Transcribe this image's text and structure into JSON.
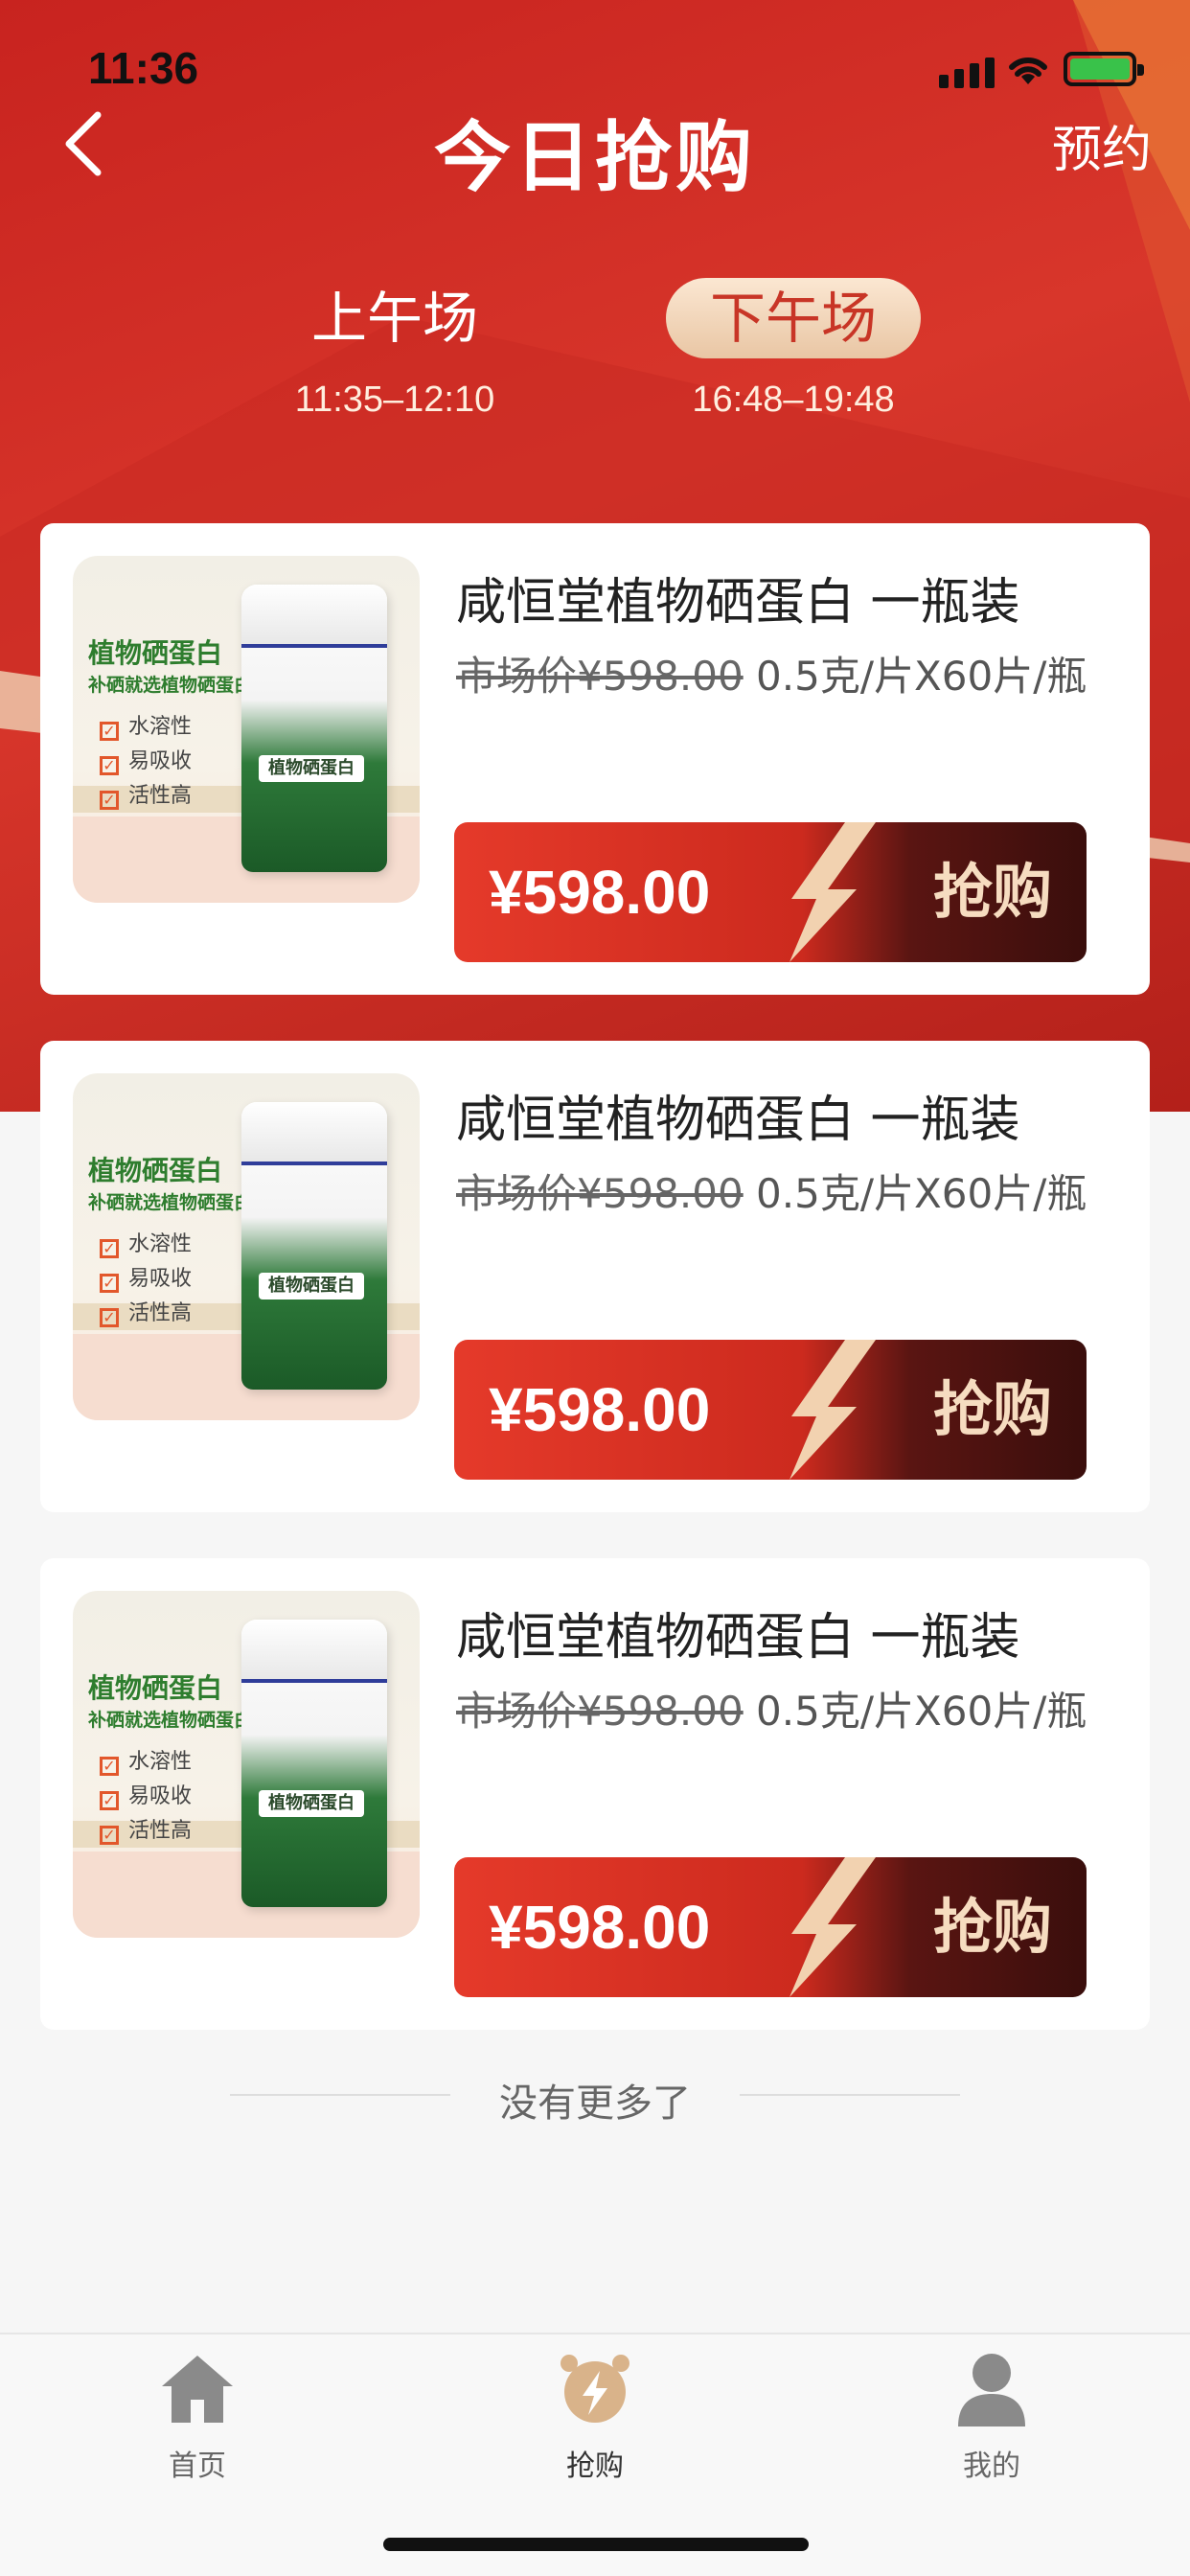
{
  "status": {
    "time": "11:36"
  },
  "nav": {
    "title": "今日抢购",
    "right_action": "预约"
  },
  "sessions": [
    {
      "label": "上午场",
      "time": "11:35–12:10",
      "active": false
    },
    {
      "label": "下午场",
      "time": "16:48–19:48",
      "active": true
    }
  ],
  "products": [
    {
      "name": "咸恒堂植物硒蛋白 一瓶装",
      "market_price": "市场价¥598.00",
      "spec": "0.5克/片X60片/瓶",
      "price": "¥598.00",
      "action": "抢购",
      "image": {
        "title": "植物硒蛋白",
        "subtitle": "补硒就选植物硒蛋白！",
        "features": [
          "水溶性",
          "易吸收",
          "活性高"
        ],
        "bottle_label": "植物硒蛋白"
      }
    },
    {
      "name": "咸恒堂植物硒蛋白 一瓶装",
      "market_price": "市场价¥598.00",
      "spec": "0.5克/片X60片/瓶",
      "price": "¥598.00",
      "action": "抢购",
      "image": {
        "title": "植物硒蛋白",
        "subtitle": "补硒就选植物硒蛋白！",
        "features": [
          "水溶性",
          "易吸收",
          "活性高"
        ],
        "bottle_label": "植物硒蛋白"
      }
    },
    {
      "name": "咸恒堂植物硒蛋白 一瓶装",
      "market_price": "市场价¥598.00",
      "spec": "0.5克/片X60片/瓶",
      "price": "¥598.00",
      "action": "抢购",
      "image": {
        "title": "植物硒蛋白",
        "subtitle": "补硒就选植物硒蛋白！",
        "features": [
          "水溶性",
          "易吸收",
          "活性高"
        ],
        "bottle_label": "植物硒蛋白"
      }
    }
  ],
  "footer": {
    "end_text": "没有更多了"
  },
  "tabbar": [
    {
      "label": "首页",
      "icon": "home-icon"
    },
    {
      "label": "抢购",
      "icon": "alarm-bolt-icon"
    },
    {
      "label": "我的",
      "icon": "person-icon"
    }
  ],
  "colors": {
    "primary": "#d02a20",
    "gold": "#f6dcc0",
    "active_tab": "#d9b38a"
  }
}
